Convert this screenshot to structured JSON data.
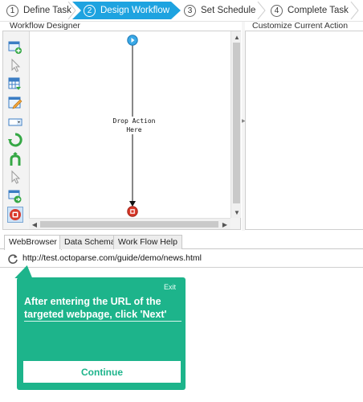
{
  "wizard": {
    "steps": [
      {
        "number": "1",
        "label": "Define Task"
      },
      {
        "number": "2",
        "label": "Design Workflow"
      },
      {
        "number": "3",
        "label": "Set Schedule"
      },
      {
        "number": "4",
        "label": "Complete Task"
      }
    ],
    "active_step": "Design Workflow",
    "accent_color": "#1ea3e0"
  },
  "workflow_designer": {
    "title": "Workflow Designer",
    "drop_line1": "Drop Action",
    "drop_line2": "Here",
    "tools": [
      "add-page-icon",
      "pointer-icon",
      "extract-data-icon",
      "enter-text-icon",
      "dropdown-icon",
      "loop-icon",
      "branch-icon",
      "pointer-icon",
      "if-condition-icon",
      "stop-icon"
    ]
  },
  "customize_action": {
    "title": "Customize Current Action"
  },
  "bottom_tabs": [
    {
      "label": "WebBrowser",
      "active": true
    },
    {
      "label": "Data Schema",
      "active": false
    },
    {
      "label": "Work Flow  Help",
      "active": false
    }
  ],
  "browser": {
    "url": "http://test.octoparse.com/guide/demo/news.html"
  },
  "tooltip": {
    "exit_label": "Exit",
    "message_line1": "After entering the URL of the",
    "message_line2": "targeted webpage, click 'Next'",
    "continue_label": "Continue",
    "color": "#1db48b"
  }
}
